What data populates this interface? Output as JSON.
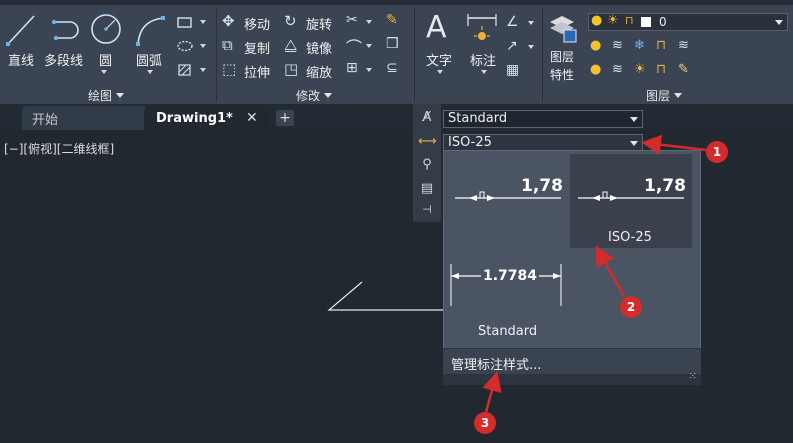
{
  "ribbon": {
    "draw_panel": {
      "line": "直线",
      "polyline": "多段线",
      "circle": "圆",
      "arc": "圆弧",
      "footer": "绘图"
    },
    "modify_panel": {
      "move": "移动",
      "rotate": "旋转",
      "copy": "复制",
      "mirror": "镜像",
      "stretch": "拉伸",
      "scale": "缩放",
      "footer": "修改"
    },
    "annotation_panel": {
      "text": "文字",
      "dimension": "标注"
    },
    "layers_panel": {
      "layer_properties_line1": "图层",
      "layer_properties_line2": "特性",
      "layer_value": "0",
      "footer": "图层"
    }
  },
  "tabs": {
    "start": "开始",
    "drawing": "Drawing1*",
    "close_glyph": "✕",
    "add_glyph": "+"
  },
  "viewport": {
    "label": "[−][俯视][二维线框]"
  },
  "annotation_styles": {
    "text_style": "Standard",
    "dim_style": "ISO-25"
  },
  "dropdown": {
    "items": [
      {
        "name": "ISO-25",
        "sample": "1,78",
        "selected": true
      },
      {
        "name": "ISO-25",
        "sample": "1,78",
        "selected": false
      },
      {
        "name": "Standard",
        "sample": "1.7784",
        "selected": false
      }
    ],
    "manage": "管理标注样式..."
  },
  "badges": [
    "1",
    "2",
    "3"
  ],
  "colors": {
    "ribbon_bg": "#3b4453",
    "canvas_bg": "#212830",
    "dropdown_bg": "#4a5463",
    "annotation_red": "#d42b2b"
  }
}
